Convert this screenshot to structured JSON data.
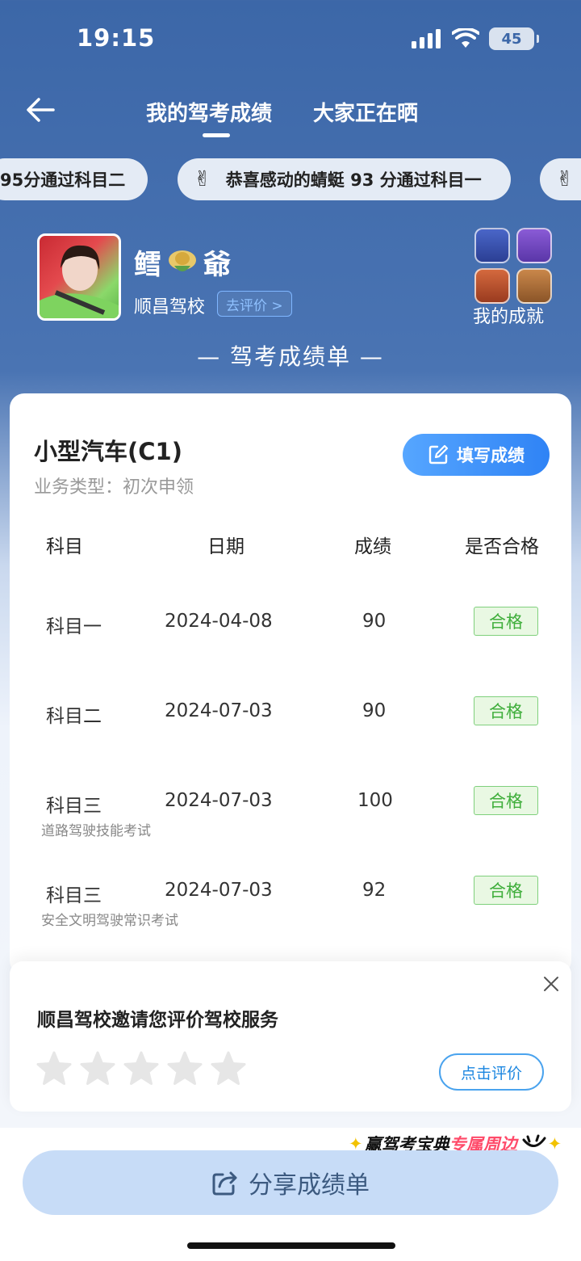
{
  "status_bar": {
    "time": "19:15",
    "battery": "45"
  },
  "nav": {
    "tabs": [
      {
        "label": "我的驾考成绩"
      },
      {
        "label": "大家正在晒"
      }
    ]
  },
  "ticker": {
    "items": [
      {
        "text": "95分通过科目二"
      },
      {
        "text": "恭喜感动的蜻蜓 93 分通过科目一"
      }
    ],
    "emoji": "✌"
  },
  "profile": {
    "name_part1": "鳕",
    "name_part2": "爺",
    "school": "顺昌驾校",
    "rate_link": "去评价 >",
    "achievements_label": "我的成就"
  },
  "section_title": "— 驾考成绩单 —",
  "card": {
    "vehicle": "小型汽车(C1)",
    "business_type": "业务类型：初次申领",
    "fill_button": "填写成绩",
    "headers": {
      "subject": "科目",
      "date": "日期",
      "score": "成绩",
      "passed": "是否合格"
    },
    "rows": [
      {
        "subject": "科目一",
        "date": "2024-04-08",
        "score": "90",
        "status": "合格",
        "note": ""
      },
      {
        "subject": "科目二",
        "date": "2024-07-03",
        "score": "90",
        "status": "合格",
        "note": ""
      },
      {
        "subject": "科目三",
        "date": "2024-07-03",
        "score": "100",
        "status": "合格",
        "note": "道路驾驶技能考试"
      },
      {
        "subject": "科目三",
        "date": "2024-07-03",
        "score": "92",
        "status": "合格",
        "note": "安全文明驾驶常识考试"
      }
    ]
  },
  "rating_popup": {
    "title": "顺昌驾校邀请您评价驾校服务",
    "button": "点击评价",
    "stars": 0,
    "max_stars": 5
  },
  "promo": {
    "part1": "赢驾考宝典",
    "part2": "专属周边"
  },
  "share_button": "分享成绩单",
  "colors": {
    "header_blue": "#3c67a8",
    "accent_blue": "#2f83f5",
    "pass_green": "#3fae3b",
    "promo_pink": "#ff4b6a"
  }
}
